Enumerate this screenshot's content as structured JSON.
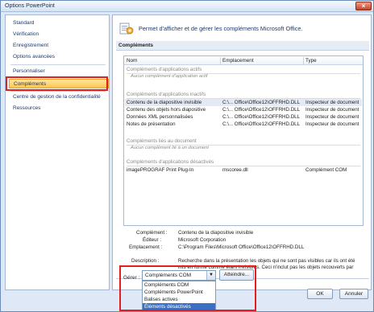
{
  "window": {
    "title": "Options PowerPoint",
    "close_glyph": "×"
  },
  "sidebar": {
    "items": [
      {
        "label": "Standard"
      },
      {
        "label": "Vérification"
      },
      {
        "label": "Enregistrement"
      },
      {
        "label": "Options avancées"
      },
      {
        "label": "Personnaliser"
      },
      {
        "label": "Compléments"
      },
      {
        "label": "Centre de gestion de la confidentialité"
      },
      {
        "label": "Ressources"
      }
    ],
    "selected": "Compléments"
  },
  "main": {
    "header": "Permet d'afficher et de gérer les compléments Microsoft Office.",
    "section_title": "Compléments",
    "table": {
      "columns": [
        "Nom",
        "Emplacement",
        "Type"
      ],
      "groups": [
        {
          "title": "Compléments d'applications actifs",
          "empty": "Aucun complément d'application actif",
          "rows": []
        },
        {
          "title": "Compléments d'applications inactifs",
          "rows": [
            {
              "name": "Contenu de la diapositive invisible",
              "location": "C:\\... Office\\Office12\\OFFRHD.DLL",
              "type": "Inspecteur de document"
            },
            {
              "name": "Contenu des objets hors diapositive",
              "location": "C:\\... Office\\Office12\\OFFRHD.DLL",
              "type": "Inspecteur de document"
            },
            {
              "name": "Données XML personnalisées",
              "location": "C:\\... Office\\Office12\\OFFRHD.DLL",
              "type": "Inspecteur de document"
            },
            {
              "name": "Notes de présentation",
              "location": "C:\\... Office\\Office12\\OFFRHD.DLL",
              "type": "Inspecteur de document"
            }
          ]
        },
        {
          "title": "Compléments liés au document",
          "empty": "Aucun complément lié à un document",
          "rows": []
        },
        {
          "title": "Compléments d'applications désactivés",
          "rows": [
            {
              "name": "imagePROGRAF Print Plug-In",
              "location": "mscoree.dll",
              "type": "Complément COM"
            }
          ]
        }
      ]
    },
    "details": {
      "addin_label": "Complément :",
      "addin_value": "Contenu de la diapositive invisible",
      "publisher_label": "Éditeur :",
      "publisher_value": "Microsoft Corporation",
      "location_label": "Emplacement :",
      "location_value": "C:\\Program Files\\Microsoft Office\\Office12\\OFFRHD.DLL",
      "description_label": "Description :",
      "description_value": "Recherche dans la présentation les objets qui ne sont pas visibles car ils ont été mis en forme comme étant invisibles. Ceci n'inclut pas les objets recouverts par d'autre..."
    },
    "manage": {
      "label": "Gérer :",
      "selected": "Compléments COM",
      "goto_label": "Atteindre...",
      "options": [
        "Compléments COM",
        "Compléments PowerPoint",
        "Balises actives",
        "Éléments désactivés"
      ],
      "hovered": "Éléments désactivés"
    }
  },
  "footer": {
    "ok_label": "OK",
    "cancel_label": "Annuler"
  },
  "colors": {
    "highlight_red": "#e01f1f",
    "selection_orange": "#ffc54d",
    "hover_blue": "#3b6fc4"
  },
  "icons": {
    "header": "addin-gear-icon",
    "dropdown": "chevron-down-icon"
  }
}
